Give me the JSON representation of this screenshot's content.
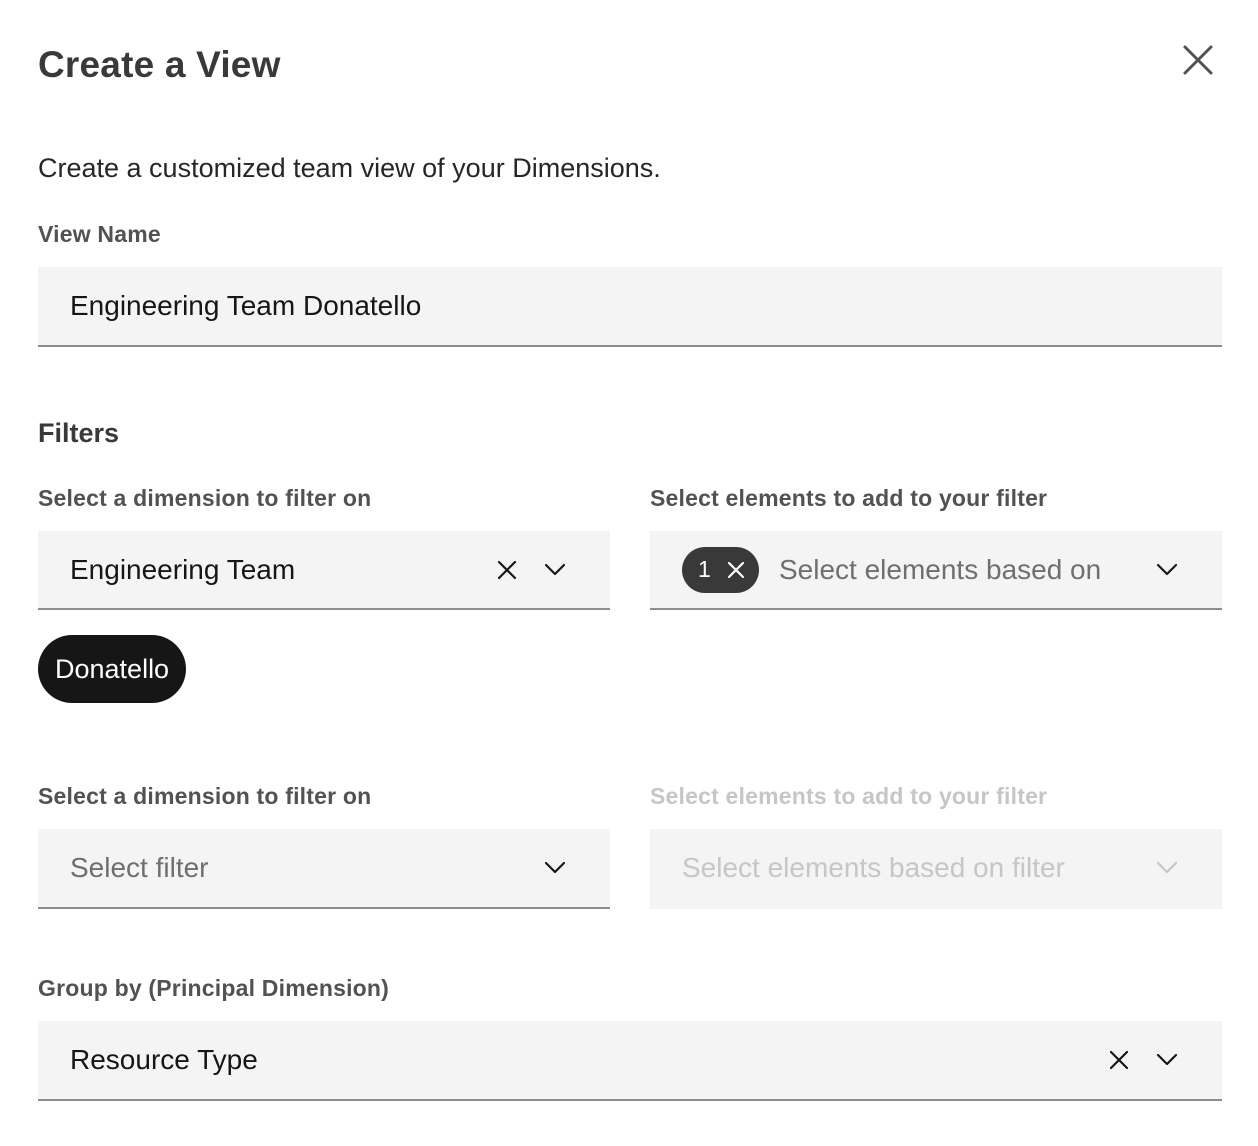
{
  "modal": {
    "title": "Create a View",
    "subtitle": "Create a customized team view of your Dimensions."
  },
  "view_name": {
    "label": "View Name",
    "value": "Engineering Team Donatello"
  },
  "filters": {
    "heading": "Filters",
    "rows": [
      {
        "dimension_label": "Select a dimension to filter on",
        "dimension_value": "Engineering Team",
        "elements_label": "Select elements to add to your filter",
        "elements_placeholder": "Select elements based on",
        "selected_count": "1",
        "selected_items": [
          "Donatello"
        ]
      },
      {
        "dimension_label": "Select a dimension to filter on",
        "dimension_placeholder": "Select filter",
        "elements_label": "Select elements to add to your filter",
        "elements_placeholder": "Select elements based on filter",
        "elements_disabled": true
      }
    ]
  },
  "group_by": {
    "label": "Group by (Principal Dimension)",
    "value": "Resource Type"
  },
  "icons": {
    "close": "close-icon",
    "clear": "clear-icon",
    "chevron": "chevron-down-icon"
  }
}
